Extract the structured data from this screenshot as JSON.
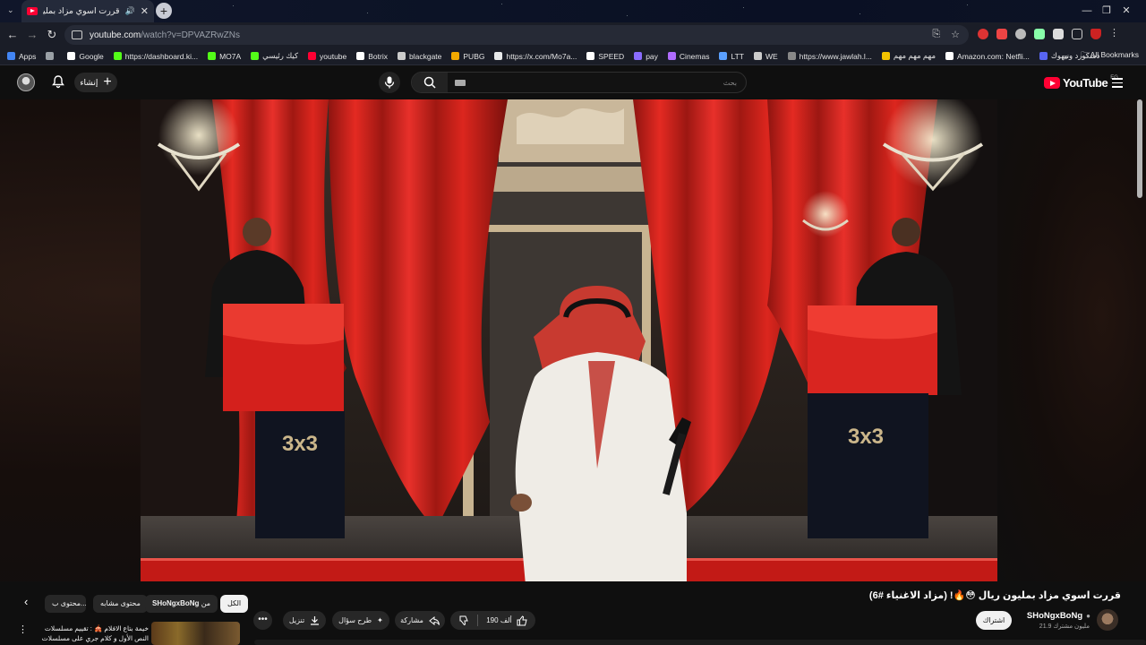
{
  "browser": {
    "tab_title": "قررت اسوي مزاد بمليون ريال",
    "url_host": "youtube.com",
    "url_path": "/watch?v=DPVAZRwZNs",
    "window_controls": {
      "minimize": "—",
      "maximize": "❐",
      "close": "✕"
    }
  },
  "bookmarks": {
    "items": [
      {
        "label": "Apps",
        "color": "#4285f4"
      },
      {
        "label": "",
        "color": "#9aa0a6"
      },
      {
        "label": "Google",
        "color": "#ffffff"
      },
      {
        "label": "https://dashboard.ki...",
        "color": "#53fc18"
      },
      {
        "label": "MO7A",
        "color": "#53fc18"
      },
      {
        "label": "كيك رئيسي",
        "color": "#53fc18"
      },
      {
        "label": "youtube",
        "color": "#ff0033"
      },
      {
        "label": "Botrix",
        "color": "#ffffff"
      },
      {
        "label": "blackgate",
        "color": "#cccccc"
      },
      {
        "label": "PUBG",
        "color": "#f2a900"
      },
      {
        "label": "https://x.com/Mo7a...",
        "color": "#e7e9ea"
      },
      {
        "label": "SPEED",
        "color": "#ffffff"
      },
      {
        "label": "pay",
        "color": "#8a6cff"
      },
      {
        "label": "Cinemas",
        "color": "#b06cff"
      },
      {
        "label": "LTT",
        "color": "#5aa0ff"
      },
      {
        "label": "WE",
        "color": "#cccccc"
      },
      {
        "label": "https://www.jawlah.l...",
        "color": "#888888"
      },
      {
        "label": "مهم مهم مهم",
        "color": "#f2c200"
      },
      {
        "label": "Amazon.com: Netfli...",
        "color": "#ffffff"
      },
      {
        "label": "دسكورد ونيهوك",
        "color": "#5865f2"
      }
    ],
    "overflow": "»",
    "all_bookmarks": "All Bookmarks"
  },
  "youtube": {
    "create_label": "إنشاء",
    "search_placeholder": "بحث",
    "logo_text": "YouTube",
    "logo_region": "EG"
  },
  "video": {
    "title": "قررت اسوي مزاد بمليون ريال 😳🔥! (مزاد الاغنياء #6)",
    "channel": "SHoNgxBoNg",
    "subscribers": "21.9 مليون مشترك",
    "subscribe_label": "اشتراك",
    "likes": "190 ألف",
    "share_label": "مشاركة",
    "ask_label": "طرح سؤال",
    "download_label": "تنزيل",
    "more_label": "•••"
  },
  "chips": {
    "all": "الكل",
    "from_prefix": "من",
    "from_channel": "SHoNgxBoNg",
    "similar": "محتوى مشابه",
    "related": "محتوى ب..."
  },
  "recommendation": {
    "title": "خيمة بتاع الافلام 🎪 : تقييم مسلسلات النص الأول و كلام جري على مسلسلات النص ..."
  },
  "colors": {
    "accent": "#ff0033",
    "background": "#0f0f0f",
    "chip_bg": "#272727",
    "curtain_red": "#d8231e"
  }
}
